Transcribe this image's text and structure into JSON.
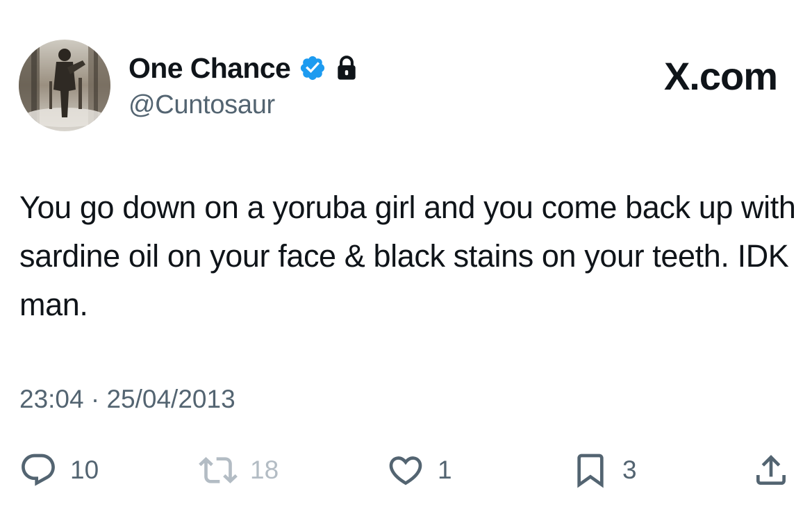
{
  "author": {
    "display_name": "One Chance",
    "handle": "@Cuntosaur",
    "verified_icon": "verified-badge-icon",
    "protected_icon": "lock-icon",
    "avatar_icon": "profile-photo"
  },
  "brand": {
    "label": "X.com"
  },
  "tweet": {
    "text": "You go down on a yoruba girl and you come back up with sardine oil on your face & black stains on your teeth. IDK man.",
    "timestamp": "23:04 · 25/04/2013"
  },
  "actions": {
    "reply": {
      "icon": "reply-icon",
      "count": "10"
    },
    "retweet": {
      "icon": "retweet-icon",
      "count": "18"
    },
    "like": {
      "icon": "heart-icon",
      "count": "1"
    },
    "bookmark": {
      "icon": "bookmark-icon",
      "count": "3"
    },
    "share": {
      "icon": "share-icon"
    }
  },
  "colors": {
    "text": "#0f1419",
    "secondary": "#536471",
    "verified": "#1d9bf0",
    "retweet_disabled": "#b3bcc4"
  }
}
